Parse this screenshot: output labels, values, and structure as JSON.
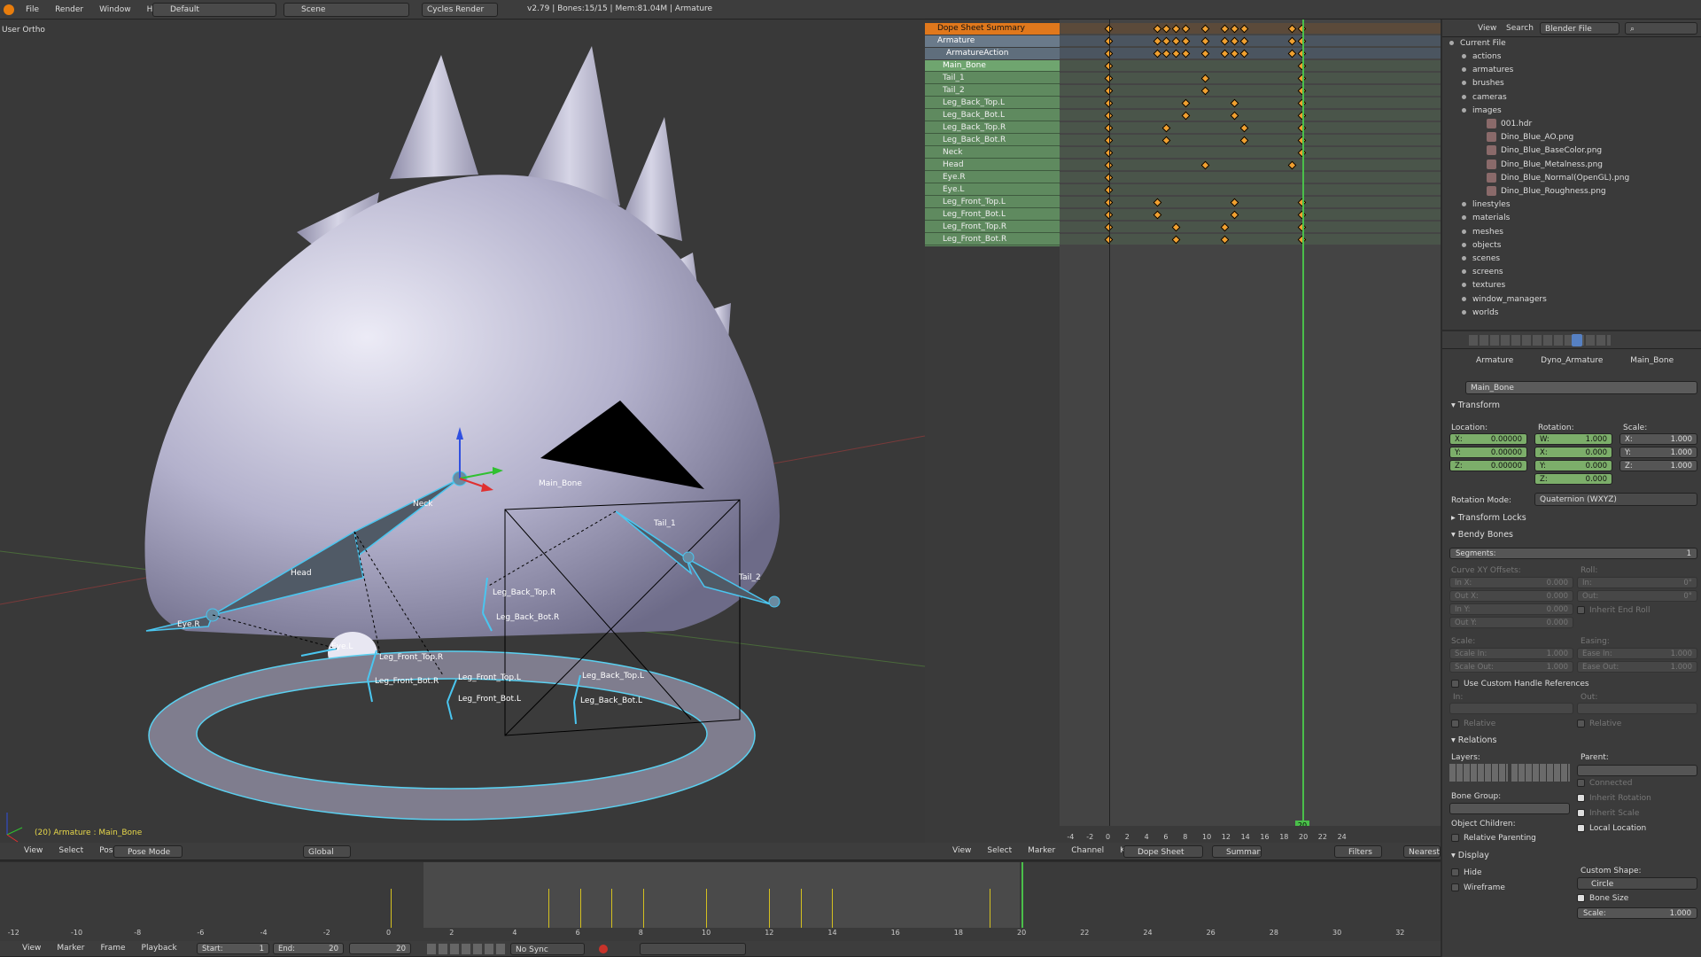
{
  "topbar": {
    "menus": [
      "File",
      "Render",
      "Window",
      "Help"
    ],
    "layout": "Default",
    "scene": "Scene",
    "engine": "Cycles Render",
    "status": "v2.79 | Bones:15/15 | Mem:81.04M | Armature"
  },
  "viewport": {
    "view_name": "User Ortho",
    "status": "(20) Armature : Main_Bone",
    "bone_labels": [
      "Main_Bone",
      "Neck",
      "Head",
      "Tail_1",
      "Tail_2",
      "Eye.R",
      "Eye.L",
      "Leg_Back_Top.R",
      "Leg_Back_Bot.R",
      "Leg_Front_Top.R",
      "Leg_Front_Bot.R",
      "Leg_Front_Top.L",
      "Leg_Front_Bot.L",
      "Leg_Back_Top.L",
      "Leg_Back_Bot.L"
    ],
    "header": {
      "menus": [
        "View",
        "Select",
        "Pose"
      ],
      "mode": "Pose Mode",
      "orientation": "Global"
    }
  },
  "dopesheet": {
    "summary": "Dope Sheet Summary",
    "armature": "Armature",
    "action": "ArmatureAction",
    "channels": [
      "Main_Bone",
      "Tail_1",
      "Tail_2",
      "Leg_Back_Top.L",
      "Leg_Back_Bot.L",
      "Leg_Back_Top.R",
      "Leg_Back_Bot.R",
      "Neck",
      "Head",
      "Eye.R",
      "Eye.L",
      "Leg_Front_Top.L",
      "Leg_Front_Bot.L",
      "Leg_Front_Top.R",
      "Leg_Front_Bot.R"
    ],
    "current_frame": "20",
    "ruler": [
      "-4",
      "-2",
      "0",
      "2",
      "4",
      "6",
      "8",
      "10",
      "12",
      "14",
      "16",
      "18",
      "20",
      "22",
      "24"
    ],
    "header": {
      "menus": [
        "View",
        "Select",
        "Marker",
        "Channel",
        "Key"
      ],
      "mode": "Dope Sheet",
      "summary": "Summary",
      "filters": "Filters",
      "snap": "Nearest Fr"
    },
    "keyframes": {
      "summary": [
        0,
        5,
        6,
        7,
        8,
        10,
        12,
        13,
        14,
        19,
        20
      ],
      "armature": [
        0,
        5,
        6,
        7,
        8,
        10,
        12,
        13,
        14,
        19,
        20
      ],
      "action": [
        0,
        5,
        6,
        7,
        8,
        10,
        12,
        13,
        14,
        19,
        20
      ],
      "rows": [
        [
          0,
          20
        ],
        [
          0,
          10,
          20
        ],
        [
          0,
          10,
          20
        ],
        [
          0,
          8,
          13,
          20
        ],
        [
          0,
          8,
          13,
          20
        ],
        [
          0,
          6,
          14,
          20
        ],
        [
          0,
          6,
          14,
          20
        ],
        [
          0,
          20
        ],
        [
          0,
          10,
          19
        ],
        [
          0
        ],
        [
          0
        ],
        [
          0,
          5,
          13,
          20
        ],
        [
          0,
          5,
          13,
          20
        ],
        [
          0,
          7,
          12,
          20
        ],
        [
          0,
          7,
          12,
          20
        ]
      ],
      "holds": [
        [
          4,
          8,
          13
        ]
      ]
    }
  },
  "outliner": {
    "header": {
      "view": "View",
      "search": "Search",
      "mode": "Blender File"
    },
    "root": "Current File",
    "items": [
      "actions",
      "armatures",
      "brushes",
      "cameras",
      "images",
      "linestyles",
      "materials",
      "meshes",
      "objects",
      "scenes",
      "screens",
      "textures",
      "window_managers",
      "worlds"
    ],
    "images": [
      "001.hdr",
      "Dino_Blue_AO.png",
      "Dino_Blue_BaseColor.png",
      "Dino_Blue_Metalness.png",
      "Dino_Blue_Normal(OpenGL).png",
      "Dino_Blue_Roughness.png"
    ]
  },
  "properties": {
    "breadcrumb": [
      "Armature",
      "Dyno_Armature",
      "Main_Bone"
    ],
    "bone_name": "Main_Bone",
    "transform": {
      "title": "Transform",
      "location_label": "Location:",
      "rotation_label": "Rotation:",
      "scale_label": "Scale:",
      "location": [
        {
          "k": "X:",
          "v": "0.00000"
        },
        {
          "k": "Y:",
          "v": "0.00000"
        },
        {
          "k": "Z:",
          "v": "0.00000"
        }
      ],
      "rotation": [
        {
          "k": "W:",
          "v": "1.000"
        },
        {
          "k": "X:",
          "v": "0.000"
        },
        {
          "k": "Y:",
          "v": "0.000"
        },
        {
          "k": "Z:",
          "v": "0.000"
        }
      ],
      "scale": [
        {
          "k": "X:",
          "v": "1.000"
        },
        {
          "k": "Y:",
          "v": "1.000"
        },
        {
          "k": "Z:",
          "v": "1.000"
        }
      ],
      "rotation_mode_label": "Rotation Mode:",
      "rotation_mode": "Quaternion (WXYZ)"
    },
    "transform_locks": "Transform Locks",
    "bendy": {
      "title": "Bendy Bones",
      "segments_label": "Segments:",
      "segments": "1",
      "curve_label": "Curve XY Offsets:",
      "roll_label": "Roll:",
      "curve": [
        {
          "k": "In X:",
          "v": "0.000"
        },
        {
          "k": "Out X:",
          "v": "0.000"
        },
        {
          "k": "In Y:",
          "v": "0.000"
        },
        {
          "k": "Out Y:",
          "v": "0.000"
        }
      ],
      "roll": [
        {
          "k": "In:",
          "v": "0°"
        },
        {
          "k": "Out:",
          "v": "0°"
        }
      ],
      "inherit_end_roll": "Inherit End Roll",
      "scale_label": "Scale:",
      "easing_label": "Easing:",
      "scale": [
        {
          "k": "Scale In:",
          "v": "1.000"
        },
        {
          "k": "Scale Out:",
          "v": "1.000"
        }
      ],
      "easing": [
        {
          "k": "Ease In:",
          "v": "1.000"
        },
        {
          "k": "Ease Out:",
          "v": "1.000"
        }
      ],
      "custom_handles": "Use Custom Handle References",
      "in_label": "In:",
      "out_label": "Out:",
      "relative": "Relative"
    },
    "relations": {
      "title": "Relations",
      "layers": "Layers:",
      "parent": "Parent:",
      "connected": "Connected",
      "inherit_rotation": "Inherit Rotation",
      "inherit_scale": "Inherit Scale",
      "bone_group": "Bone Group:",
      "object_children": "Object Children:",
      "local_location": "Local Location",
      "relative_parenting": "Relative Parenting"
    },
    "display": {
      "title": "Display",
      "hide": "Hide",
      "wireframe": "Wireframe",
      "custom_shape_label": "Custom Shape:",
      "custom_shape": "Circle",
      "bone_size": "Bone Size",
      "scale": "Scale:",
      "scale_value": "1.000"
    }
  },
  "timeline": {
    "ruler": [
      "-12",
      "-10",
      "-8",
      "-6",
      "-4",
      "-2",
      "0",
      "2",
      "4",
      "6",
      "8",
      "10",
      "12",
      "14",
      "16",
      "18",
      "20",
      "22",
      "24",
      "26",
      "28",
      "30",
      "32"
    ],
    "key_frames": [
      0,
      5,
      6,
      7,
      8,
      10,
      12,
      13,
      14,
      19
    ],
    "current_frame": 20,
    "menus": [
      "View",
      "Marker",
      "Frame",
      "Playback"
    ],
    "start_label": "Start:",
    "start": "1",
    "end_label": "End:",
    "end": "20",
    "frame": "20",
    "sync": "No Sync"
  }
}
